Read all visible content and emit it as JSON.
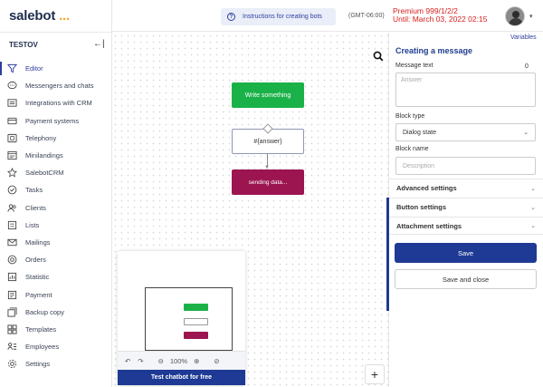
{
  "logo": {
    "name": "salebot",
    "dots": "..."
  },
  "project": {
    "name": "TESTOV",
    "collapse_icon": "←|"
  },
  "sidebar": {
    "items": [
      {
        "label": "Editor",
        "icon": "filter-icon"
      },
      {
        "label": "Messengers and chats",
        "icon": "chat-icon"
      },
      {
        "label": "Integrations with CRM",
        "icon": "integration-icon"
      },
      {
        "label": "Payment systems",
        "icon": "card-icon"
      },
      {
        "label": "Telephony",
        "icon": "phone-icon"
      },
      {
        "label": "Minilandings",
        "icon": "landing-icon"
      },
      {
        "label": "SalebotCRM",
        "icon": "star-icon"
      },
      {
        "label": "Tasks",
        "icon": "check-circle-icon"
      },
      {
        "label": "Clients",
        "icon": "users-icon"
      },
      {
        "label": "Lists",
        "icon": "list-icon"
      },
      {
        "label": "Mailings",
        "icon": "mail-icon"
      },
      {
        "label": "Orders",
        "icon": "orders-icon"
      },
      {
        "label": "Statistic",
        "icon": "chart-icon"
      },
      {
        "label": "Payment",
        "icon": "wallet-icon"
      },
      {
        "label": "Backup copy",
        "icon": "backup-icon"
      },
      {
        "label": "Templates",
        "icon": "templates-icon"
      },
      {
        "label": "Employees",
        "icon": "employees-icon"
      },
      {
        "label": "Settings",
        "icon": "gear-icon"
      }
    ]
  },
  "topbar": {
    "instructions_label": "Instructions for creating bots",
    "timezone": "(GMT-06:00)",
    "premium_line1": "Premium 999/1/2/2",
    "premium_line2": "Until: March 03, 2022 02:15"
  },
  "canvas": {
    "node_start": "Write something",
    "node_mid": "#{answer}",
    "node_end": "sending data..."
  },
  "minimap": {
    "zoom": "100%",
    "test_button": "Test chatbot for free"
  },
  "panel": {
    "variables_link": "Variables",
    "title": "Creating a message",
    "message_text_label": "Message text",
    "message_counter": "0",
    "message_placeholder": "Answer",
    "block_type_label": "Block type",
    "block_type_value": "Dialog state",
    "block_name_label": "Block name",
    "block_name_placeholder": "Description",
    "accordions": [
      "Advanced settings",
      "Button settings",
      "Attachment settings"
    ],
    "save_label": "Save",
    "save_close_label": "Save and close"
  },
  "colors": {
    "primary": "#1e3a94",
    "start_node": "#1ab248",
    "end_node": "#9c1550",
    "premium_text": "#d81e1e",
    "logo_dots": "#f5a623"
  }
}
